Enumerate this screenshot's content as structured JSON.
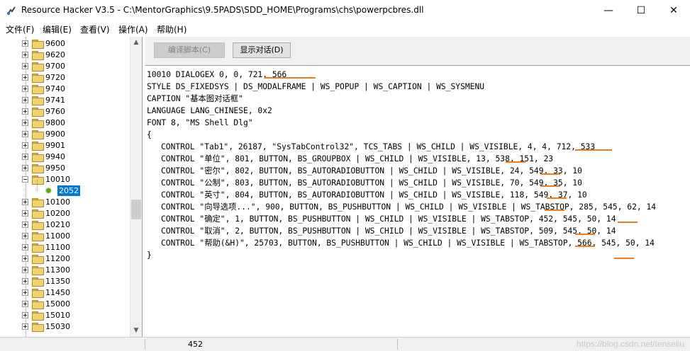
{
  "window": {
    "title": "Resource Hacker V3.5  -  C:\\MentorGraphics\\9.5PADS\\SDD_HOME\\Programs\\chs\\powerpcbres.dll",
    "controls": {
      "minimize": "—",
      "maximize": "☐",
      "close": "✕"
    }
  },
  "menu": [
    "文件(F)",
    "编辑(E)",
    "查看(V)",
    "操作(A)",
    "帮助(H)"
  ],
  "tree": {
    "items": [
      "9600",
      "9620",
      "9700",
      "9720",
      "9740",
      "9741",
      "9760",
      "9800",
      "9900",
      "9901",
      "9940",
      "9950",
      "10010",
      "10100",
      "10200",
      "10210",
      "11000",
      "11100",
      "11200",
      "11300",
      "11350",
      "11450",
      "15000",
      "15010",
      "15030"
    ],
    "expanded": "10010",
    "selected_child": "2052"
  },
  "toolbar": {
    "compile_label": "编译脚本(C)",
    "show_dialog_label": "显示对话(D)"
  },
  "code": {
    "lines": [
      "10010 DIALOGEX 0, 0, 721, 566",
      "STYLE DS_FIXEDSYS | DS_MODALFRAME | WS_POPUP | WS_CAPTION | WS_SYSMENU",
      "CAPTION \"基本图对话框\"",
      "LANGUAGE LANG_CHINESE, 0x2",
      "FONT 8, \"MS Shell Dlg\"",
      "{",
      "CONTROL \"Tab1\", 26187, \"SysTabControl32\", TCS_TABS | WS_CHILD | WS_VISIBLE, 4, 4, 712, 533",
      "CONTROL \"单位\", 801, BUTTON, BS_GROUPBOX | WS_CHILD | WS_VISIBLE, 13, 538, 151, 23",
      "CONTROL \"密尔\", 802, BUTTON, BS_AUTORADIOBUTTON | WS_CHILD | WS_VISIBLE, 24, 549, 33, 10",
      "CONTROL \"公制\", 803, BUTTON, BS_AUTORADIOBUTTON | WS_CHILD | WS_VISIBLE, 70, 549, 35, 10",
      "CONTROL \"英寸\", 804, BUTTON, BS_AUTORADIOBUTTON | WS_CHILD | WS_VISIBLE, 118, 549, 37, 10",
      "CONTROL \"向导选项...\", 900, BUTTON, BS_PUSHBUTTON | WS_CHILD | WS_VISIBLE | WS_TABSTOP, 285, 545, 62, 14",
      "CONTROL \"确定\", 1, BUTTON, BS_PUSHBUTTON | WS_CHILD | WS_VISIBLE | WS_TABSTOP, 452, 545, 50, 14",
      "CONTROL \"取消\", 2, BUTTON, BS_PUSHBUTTON | WS_CHILD | WS_VISIBLE | WS_TABSTOP, 509, 545, 50, 14",
      "CONTROL \"帮助(&H)\", 25703, BUTTON, BS_PUSHBUTTON | WS_CHILD | WS_VISIBLE | WS_TABSTOP, 566, 545, 50, 14",
      "}"
    ],
    "annotation_color": "#f07c1c"
  },
  "status": {
    "position": "452"
  },
  "watermark": "https://blog.csdn.net/tenseliu"
}
